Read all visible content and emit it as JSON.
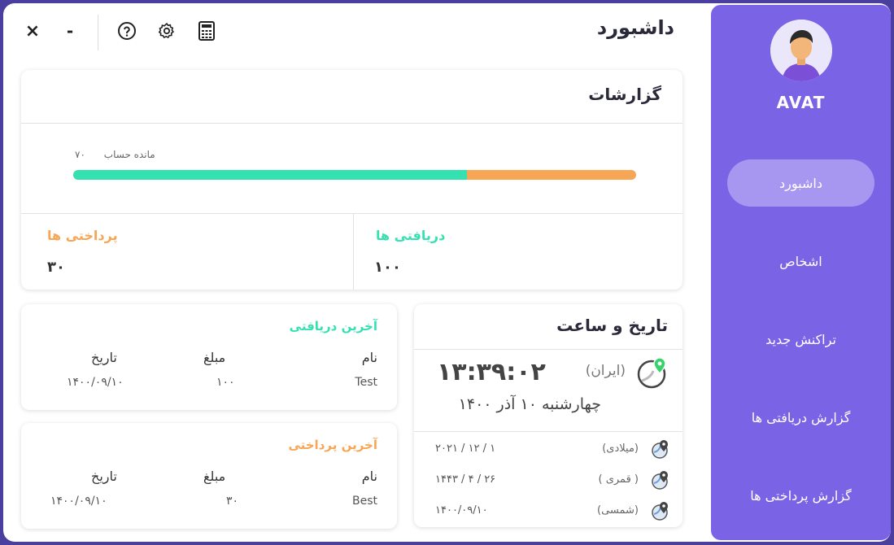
{
  "header": {
    "title": "داشبورد",
    "close_symbol": "×",
    "minimize_symbol": "-",
    "icons": [
      "close-icon",
      "minimize-icon",
      "help-icon",
      "gear-icon",
      "calculator-icon"
    ]
  },
  "sidebar": {
    "username": "AVAT",
    "items": [
      {
        "label": "داشبورد",
        "active": true
      },
      {
        "label": "اشخاص",
        "active": false
      },
      {
        "label": "تراکنش جدید",
        "active": false
      },
      {
        "label": "گزارش دریافتی ها",
        "active": false
      },
      {
        "label": "گزارش پرداختی ها",
        "active": false
      }
    ]
  },
  "reports": {
    "title": "گزارشات",
    "balance_label": "مانده حساب",
    "balance_value": "۷۰",
    "received_share": 0.7,
    "received": {
      "label": "دریافتی ها",
      "value": "۱۰۰"
    },
    "paid": {
      "label": "پرداختی ها",
      "value": "۳۰"
    }
  },
  "datetime": {
    "title": "تاریخ و ساعت",
    "time": "۱۳:۳۹:۰۲",
    "zone": "(ایران)",
    "date_text": "چهارشنبه ۱۰ آذر ۱۴۰۰",
    "calendars": [
      {
        "name": "(میلادی)",
        "value": "۲۰۲۱ / ۱۲ / ۱"
      },
      {
        "name": "( قمری )",
        "value": "۱۴۴۳ / ۴ / ۲۶"
      },
      {
        "name": "(شمسی)",
        "value": "۱۴۰۰/۰۹/۱۰"
      }
    ]
  },
  "last_received": {
    "title": "آخرین دریافتی",
    "headers": {
      "name": "نام",
      "amount": "مبلغ",
      "date": "تاریخ"
    },
    "row": {
      "name": "Test",
      "amount": "۱۰۰",
      "date": "۱۴۰۰/۰۹/۱۰"
    }
  },
  "last_paid": {
    "title": "آخرین پرداختی",
    "headers": {
      "name": "نام",
      "amount": "مبلغ",
      "date": "تاریخ"
    },
    "row": {
      "name": "Best",
      "amount": "۳۰",
      "date": "۱۴۰۰/۰۹/۱۰"
    }
  },
  "colors": {
    "sidebar": "#7b63e6",
    "received": "#35e0b1",
    "paid": "#f7a655"
  }
}
